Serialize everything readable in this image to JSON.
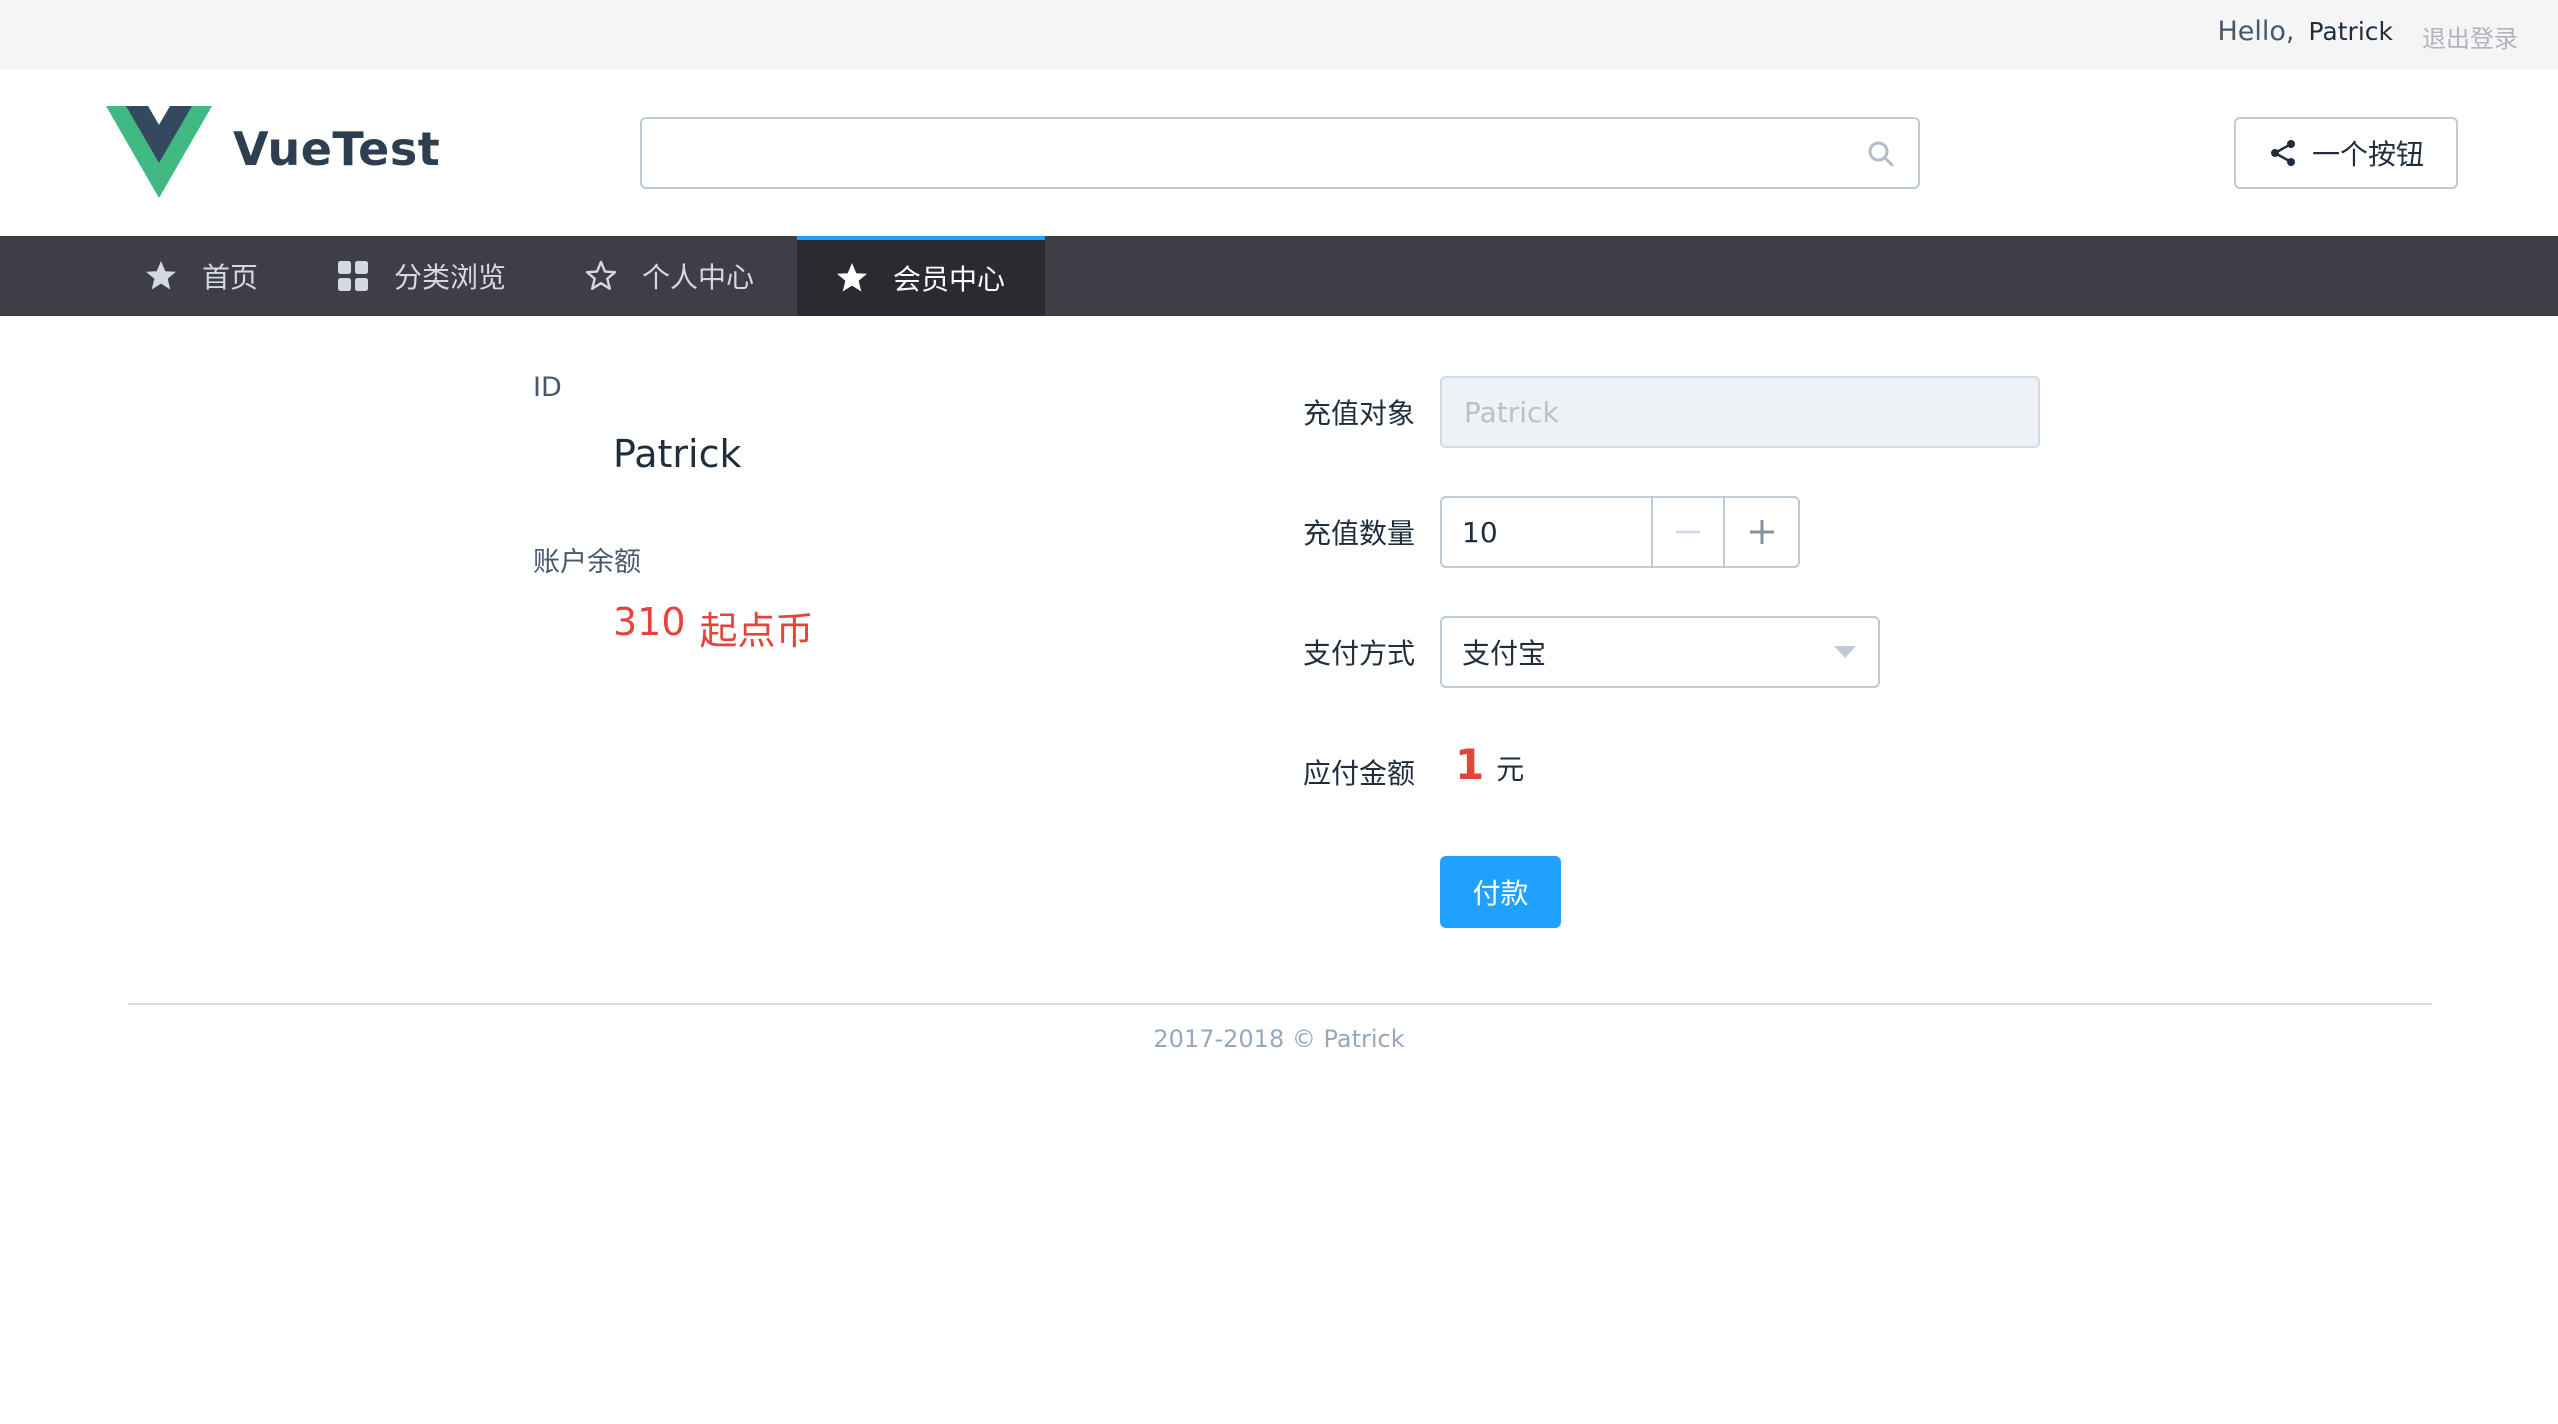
{
  "topbar": {
    "greeting": "Hello,",
    "username": "Patrick",
    "logout_label": "退出登录"
  },
  "header": {
    "brand": "VueTest",
    "search": {
      "placeholder": "",
      "value": ""
    },
    "share_button_label": "一个按钮"
  },
  "nav": {
    "items": [
      {
        "label": "首页",
        "icon": "star-filled-icon",
        "active": false
      },
      {
        "label": "分类浏览",
        "icon": "grid-icon",
        "active": false
      },
      {
        "label": "个人中心",
        "icon": "star-outline-icon",
        "active": false
      },
      {
        "label": "会员中心",
        "icon": "star-filled-icon",
        "active": true
      }
    ]
  },
  "account": {
    "id_label": "ID",
    "name": "Patrick",
    "balance_label": "账户余额",
    "balance_amount": "310",
    "balance_unit": "起点币"
  },
  "recharge_form": {
    "target_label": "充值对象",
    "target_value": "Patrick",
    "quantity_label": "充值数量",
    "quantity_value": "10",
    "payment_label": "支付方式",
    "payment_value": "支付宝",
    "due_label": "应付金额",
    "due_amount": "1",
    "due_unit": "元",
    "pay_button_label": "付款"
  },
  "footer": {
    "text": "2017-2018 © Patrick"
  },
  "colors": {
    "accent": "#20a0ff",
    "nav_bg": "#3e3f46",
    "nav_active_bg": "#2a2b31",
    "price_red": "#e8433a",
    "vue_green": "#42b983",
    "vue_dark": "#35495e"
  }
}
